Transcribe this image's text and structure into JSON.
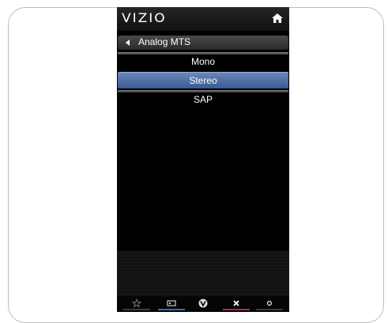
{
  "app": {
    "brand": "VIZIO"
  },
  "menu": {
    "title": "Analog MTS",
    "items": [
      {
        "label": "Mono",
        "selected": false
      },
      {
        "label": "Stereo",
        "selected": true
      },
      {
        "label": "SAP",
        "selected": false
      }
    ]
  },
  "icons": {
    "home": "home-icon",
    "back": "back-arrow-icon",
    "favorites": "star-icon",
    "input": "input-icon",
    "vizio": "vizio-logo-icon",
    "exit": "close-icon",
    "settings": "gear-icon"
  },
  "colors": {
    "selected_accent": "#4a6ba3",
    "background": "#000000",
    "exit_accent": "#b8264a",
    "input_accent": "#2f6fb5"
  }
}
